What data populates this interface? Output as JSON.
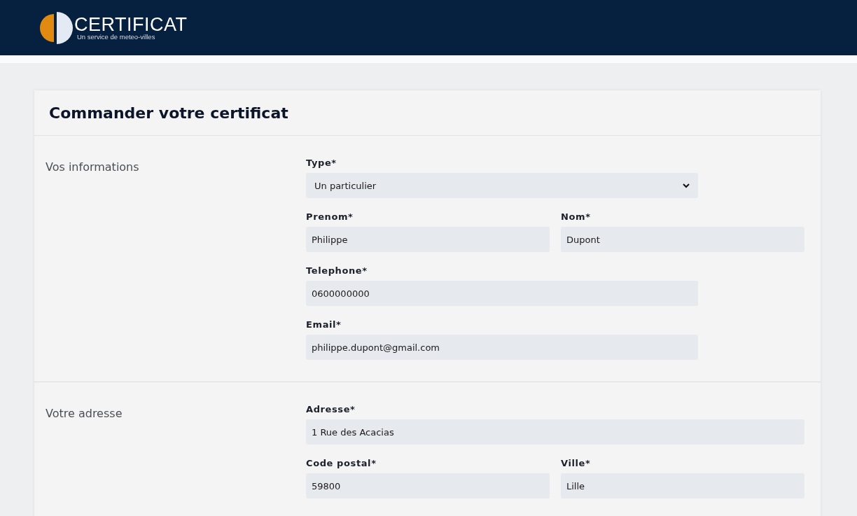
{
  "header": {
    "logo_title": "CERTIFICAT",
    "logo_subtitle": "Un service de meteo-villes"
  },
  "card": {
    "title": "Commander votre certificat",
    "sections": [
      {
        "label": "Vos informations",
        "rows": [
          {
            "fields": [
              {
                "kind": "select",
                "label": "Type*",
                "value": "Un particulier",
                "wide": false
              }
            ]
          },
          {
            "fields": [
              {
                "kind": "input",
                "label": "Prenom*",
                "value": "Philippe",
                "wide": false
              },
              {
                "kind": "input",
                "label": "Nom*",
                "value": "Dupont",
                "wide": false
              }
            ]
          },
          {
            "fields": [
              {
                "kind": "input",
                "label": "Telephone*",
                "value": "0600000000",
                "wide": false
              }
            ]
          },
          {
            "fields": [
              {
                "kind": "input",
                "label": "Email*",
                "value": "philippe.dupont@gmail.com",
                "wide": false
              }
            ]
          }
        ]
      },
      {
        "label": "Votre adresse",
        "rows": [
          {
            "fields": [
              {
                "kind": "input",
                "label": "Adresse*",
                "value": "1 Rue des Acacias",
                "wide": true
              }
            ]
          },
          {
            "fields": [
              {
                "kind": "input",
                "label": "Code postal*",
                "value": "59800",
                "wide": false
              },
              {
                "kind": "input",
                "label": "Ville*",
                "value": "Lille",
                "wide": false
              }
            ]
          }
        ]
      }
    ]
  }
}
